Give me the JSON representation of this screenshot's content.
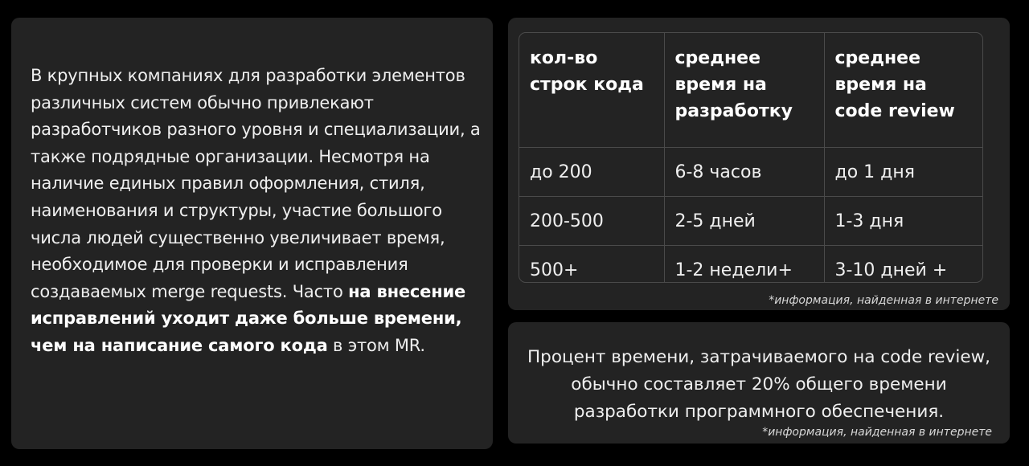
{
  "left_card": {
    "text_regular": "В крупных компаниях для разработки элементов различных систем обычно привлекают разработчиков разного уровня и специализации, а также подрядные организации. Несмотря на наличие единых правил оформления, стиля, наименования и структуры, участие большого числа людей существенно увеличивает время, необходимое для проверки и исправления создаваемых merge requests. Часто ",
    "text_bold": "на внесение исправлений уходит даже больше времени, чем на написание самого кода",
    "text_end": " в этом MR."
  },
  "table_card": {
    "headers": [
      "кол-во строк кода",
      "среднее время на разработку",
      "среднее время на code review"
    ],
    "rows": [
      [
        "до 200",
        "6-8 часов",
        "до 1 дня"
      ],
      [
        "200-500",
        "2-5 дней",
        "1-3 дня"
      ],
      [
        "500+",
        "1-2 недели+",
        "3-10 дней +"
      ]
    ],
    "note": "*информация, найденная в интернете"
  },
  "bottom_card": {
    "text": "Процент времени, затрачиваемого на code review, обычно составляет 20% общего времени разработки программного обеспечения.",
    "note": "*информация, найденная в интернете"
  }
}
